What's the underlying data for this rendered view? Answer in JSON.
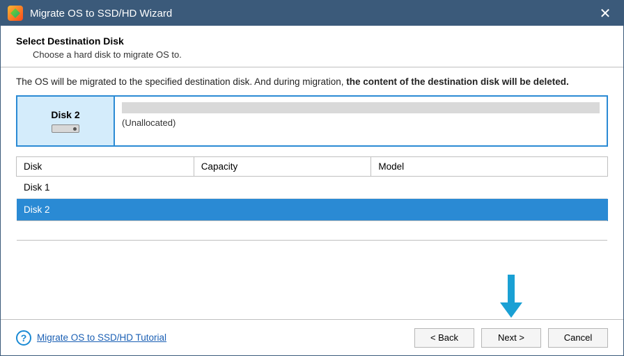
{
  "titlebar": {
    "title": "Migrate OS to SSD/HD Wizard"
  },
  "header": {
    "heading": "Select Destination Disk",
    "sub": "Choose a hard disk to migrate OS to."
  },
  "warning": {
    "prefix": "The OS will be migrated to the specified destination disk. And during migration, ",
    "bold": "the content of the destination disk will be deleted."
  },
  "selected_disk": {
    "name": "Disk 2",
    "state": "(Unallocated)"
  },
  "table": {
    "columns": [
      "Disk",
      "Capacity",
      "Model"
    ],
    "rows": [
      {
        "disk": "Disk 1",
        "capacity": "",
        "model": "",
        "selected": false
      },
      {
        "disk": "Disk 2",
        "capacity": "",
        "model": "",
        "selected": true
      }
    ]
  },
  "footer": {
    "tutorial": "Migrate OS to SSD/HD Tutorial",
    "back": "< Back",
    "next": "Next >",
    "cancel": "Cancel"
  }
}
